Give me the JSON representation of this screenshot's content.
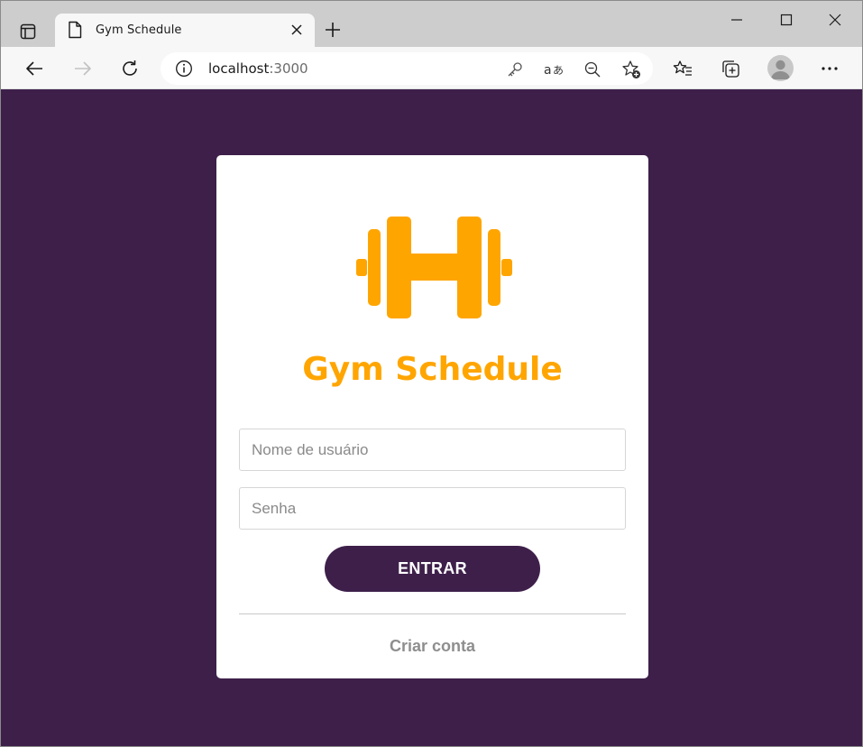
{
  "browser": {
    "tab_title": "Gym Schedule",
    "url_host": "localhost",
    "url_port": ":3000",
    "icons": {
      "tab_actions": "tab-actions-icon",
      "favicon": "page-icon",
      "tab_close": "close-icon",
      "new_tab": "plus-icon",
      "minimize": "minimize-icon",
      "maximize": "maximize-icon",
      "window_close": "close-icon",
      "back": "arrow-left-icon",
      "forward": "arrow-right-icon",
      "refresh": "refresh-icon",
      "site_info": "info-icon",
      "password": "key-icon",
      "translate": "translate-icon",
      "zoom": "zoom-out-icon",
      "add_favorite": "star-add-icon",
      "favorites": "favorites-icon",
      "collections": "collections-icon",
      "profile": "avatar",
      "menu": "more-icon"
    }
  },
  "page": {
    "brand": "Gym Schedule",
    "username_placeholder": "Nome de usuário",
    "password_placeholder": "Senha",
    "enter_label": "ENTRAR",
    "create_account_label": "Criar conta",
    "colors": {
      "background": "#3e1f4a",
      "accent": "#ffa500",
      "button": "#3e1f4a",
      "link": "#8e8e8e"
    }
  }
}
